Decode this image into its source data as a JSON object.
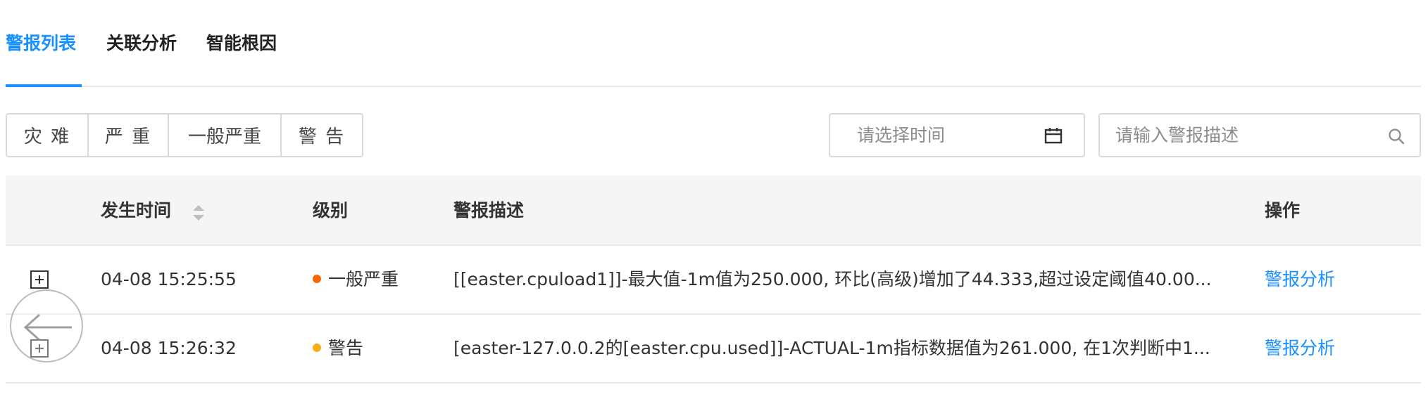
{
  "tabs": [
    {
      "label": "警报列表",
      "active": true
    },
    {
      "label": "关联分析",
      "active": false
    },
    {
      "label": "智能根因",
      "active": false
    }
  ],
  "filters": {
    "levels": [
      "灾 难",
      "严 重",
      "一般严重",
      "警 告"
    ],
    "date_placeholder": "请选择时间",
    "search_placeholder": "请输入警报描述"
  },
  "table": {
    "headers": {
      "time": "发生时间",
      "level": "级别",
      "description": "警报描述",
      "action": "操作"
    },
    "rows": [
      {
        "time": "04-08 15:25:55",
        "level": "一般严重",
        "level_color": "#fa6400",
        "description": "[[easter.cpuload1]]-最大值-1m值为250.000, 环比(高级)增加了44.333,超过设定阈值40.00...",
        "action": "警报分析"
      },
      {
        "time": "04-08 15:26:32",
        "level": "警告",
        "level_color": "#faad14",
        "description": "[easter-127.0.0.2的[easter.cpu.used]]-ACTUAL-1m指标数据值为261.000, 在1次判断中1...",
        "action": "警报分析"
      }
    ]
  },
  "colors": {
    "accent": "#1890ff",
    "border": "#d9d9d9",
    "header_bg": "#f5f5f5"
  }
}
